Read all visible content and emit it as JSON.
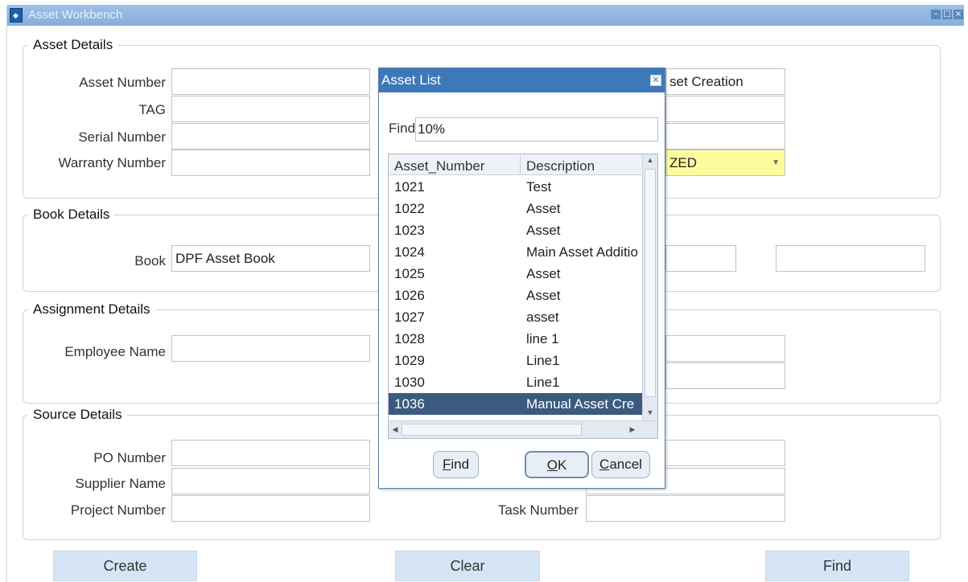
{
  "window": {
    "title": "Asset Workbench",
    "controls": [
      "–",
      "□",
      "×"
    ]
  },
  "asset_details": {
    "title": "Asset Details",
    "asset_number_label": "Asset Number",
    "tag_label": "TAG",
    "serial_number_label": "Serial Number",
    "warranty_number_label": "Warranty Number",
    "partial_right_value": "set Creation",
    "partial_status_value": "ZED"
  },
  "book_details": {
    "title": "Book Details",
    "book_label": "Book",
    "book_value": "DPF Asset Book"
  },
  "assignment_details": {
    "title": "Assignment Details",
    "employee_name_label": "Employee Name"
  },
  "source_details": {
    "title": "Source Details",
    "po_number_label": "PO Number",
    "supplier_name_label": "Supplier Name",
    "project_number_label": "Project Number",
    "task_number_label": "Task Number"
  },
  "buttons": {
    "create": "Create",
    "clear": "Clear",
    "find": "Find"
  },
  "asset_list": {
    "title": "Asset List",
    "find_label": "Find",
    "find_value": "10%",
    "columns": [
      "Asset_Number",
      "Description"
    ],
    "rows": [
      {
        "number": "1021",
        "description": "Test"
      },
      {
        "number": "1022",
        "description": "Asset"
      },
      {
        "number": "1023",
        "description": "Asset"
      },
      {
        "number": "1024",
        "description": "Main Asset Additio"
      },
      {
        "number": "1025",
        "description": "Asset"
      },
      {
        "number": "1026",
        "description": "Asset"
      },
      {
        "number": "1027",
        "description": "asset"
      },
      {
        "number": "1028",
        "description": "line 1"
      },
      {
        "number": "1029",
        "description": "Line1"
      },
      {
        "number": "1030",
        "description": "Line1"
      },
      {
        "number": "1036",
        "description": "Manual Asset Cre"
      }
    ],
    "selected_asset_number": "1036",
    "buttons": {
      "find_first": "F",
      "find_rest": "ind",
      "ok_first": "O",
      "ok_rest": "K",
      "cancel_first": "C",
      "cancel_rest": "ancel"
    }
  }
}
